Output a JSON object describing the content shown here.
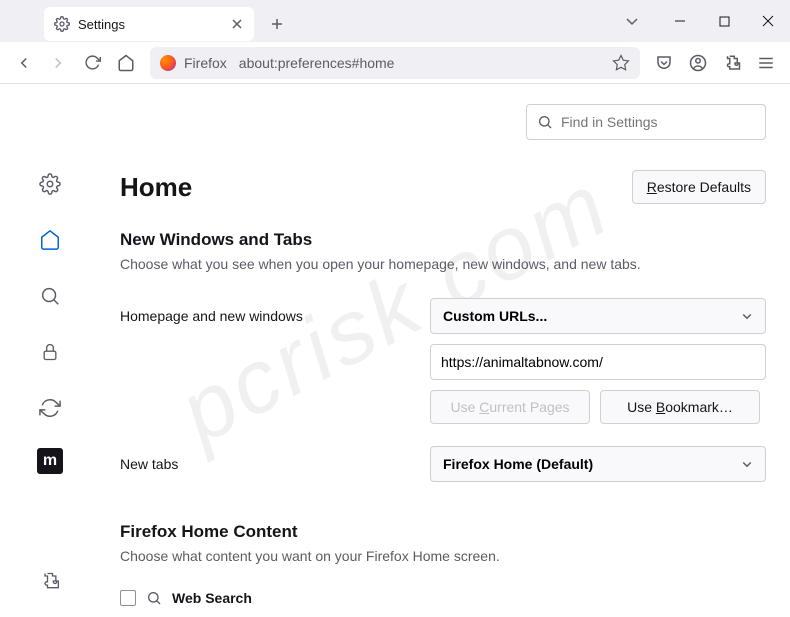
{
  "tab": {
    "title": "Settings"
  },
  "urlbar": {
    "brand": "Firefox",
    "url": "about:preferences#home"
  },
  "search": {
    "placeholder": "Find in Settings"
  },
  "page": {
    "title": "Home",
    "restore": "Restore Defaults",
    "restore_u": "R",
    "section1_title": "New Windows and Tabs",
    "section1_desc": "Choose what you see when you open your homepage, new windows, and new tabs.",
    "homepage_label": "Homepage and new windows",
    "homepage_select": "Custom URLs...",
    "homepage_value": "https://animaltabnow.com/",
    "use_current": "Use Current Pages",
    "use_current_u": "C",
    "use_bookmark": "Use Bookmark…",
    "use_bookmark_u": "B",
    "newtabs_label": "New tabs",
    "newtabs_select": "Firefox Home (Default)",
    "section2_title": "Firefox Home Content",
    "section2_desc": "Choose what content you want on your Firefox Home screen.",
    "websearch": "Web Search"
  },
  "sidebar": {
    "mozilla": "m"
  },
  "watermark": "pcrisk.com"
}
